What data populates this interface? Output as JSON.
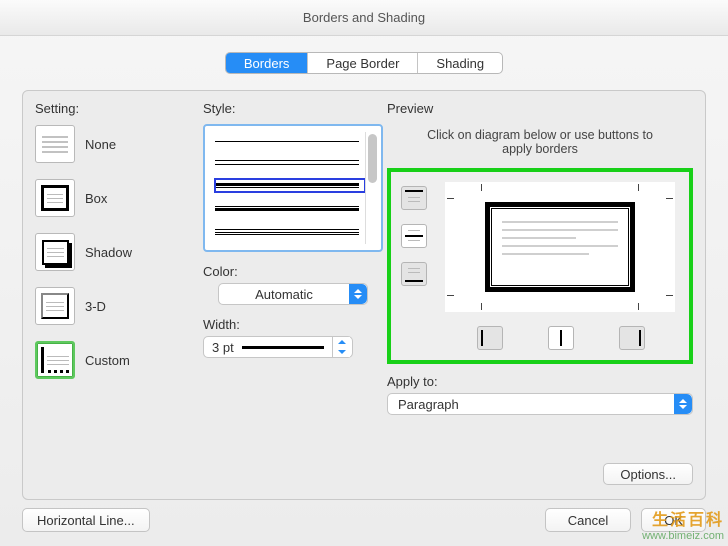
{
  "window": {
    "title": "Borders and Shading"
  },
  "tabs": {
    "borders": "Borders",
    "page_border": "Page Border",
    "shading": "Shading",
    "active": "borders"
  },
  "settings": {
    "heading": "Setting:",
    "items": [
      {
        "key": "none",
        "label": "None"
      },
      {
        "key": "box",
        "label": "Box"
      },
      {
        "key": "shadow",
        "label": "Shadow"
      },
      {
        "key": "3d",
        "label": "3-D"
      },
      {
        "key": "custom",
        "label": "Custom"
      }
    ],
    "selected": "custom"
  },
  "style": {
    "heading": "Style:",
    "selected_index": 2
  },
  "color": {
    "heading": "Color:",
    "value": "Automatic"
  },
  "width": {
    "heading": "Width:",
    "value": "3 pt"
  },
  "preview": {
    "heading": "Preview",
    "help": "Click on diagram below or use buttons to apply borders"
  },
  "apply": {
    "heading": "Apply to:",
    "value": "Paragraph"
  },
  "buttons": {
    "options": "Options...",
    "horizontal_line": "Horizontal Line...",
    "cancel": "Cancel",
    "ok": "OK"
  },
  "watermark": {
    "brand": "生活百科",
    "url": "www.bimeiz.com"
  }
}
